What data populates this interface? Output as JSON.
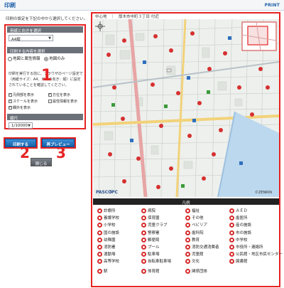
{
  "header": {
    "title": "印刷",
    "print_link": "PRINT"
  },
  "instruction": "印刷の設定を下記の中から選択してください。",
  "settings": {
    "paper_section_label": "用紙と向きを選択",
    "paper_value": "A4縦",
    "content_section_label": "印刷する内容を選択",
    "radio_options": [
      {
        "label": "地図と属性情報",
        "selected": false
      },
      {
        "label": "地図のみ",
        "selected": true
      }
    ],
    "note": "印刷を実行する前に、ブラウザのページ設定で（用紙サイズ：A4、印刷の向き：縦）に設定されていることを確認してください。",
    "checkboxes": [
      {
        "label": "凡例部を表示",
        "checked": true
      },
      {
        "label": "方位を表示",
        "checked": true
      },
      {
        "label": "スケールを表示",
        "checked": true
      },
      {
        "label": "属性情報を表示",
        "checked": false
      },
      {
        "label": "欄外を表示",
        "checked": true
      }
    ],
    "scale_section_label": "縮尺",
    "scale_value": "1/10000"
  },
  "buttons": {
    "print": "印刷する",
    "preview": "再プレビュー",
    "close": "閉じる"
  },
  "callouts": [
    "1",
    "2",
    "3",
    "4"
  ],
  "map": {
    "address_bar": "中心地　｜　厚木市中町３丁目 付近",
    "copyright": "©ZENRIN",
    "logo_1": "PASCO",
    "logo_2": "iPC"
  },
  "legend": {
    "title": "凡例",
    "items": [
      "診療所",
      "病院",
      "福祉",
      "ＡＥＤ",
      "養護学校",
      "保育園",
      "その他",
      "歯医所",
      "小学校",
      "児童クラブ",
      "ペビリア",
      "産の施設",
      "国の施設",
      "警察署",
      "歯科院",
      "市の施設",
      "幼稚園",
      "郵便局",
      "教育",
      "中学校",
      "消防署",
      "プール",
      "消防交通消費者",
      "市役所・連絡所",
      "運動場",
      "駐車場",
      "児童館",
      "公民館・地区市民センター",
      "高等学校",
      "自転車駐車場",
      "文化",
      "図書館",
      "駅",
      "体育館",
      "関係団体",
      ""
    ]
  },
  "colors": {
    "highlight": "#e62323",
    "primary_button": "#1562ab",
    "header_text": "#1f5fa8"
  }
}
